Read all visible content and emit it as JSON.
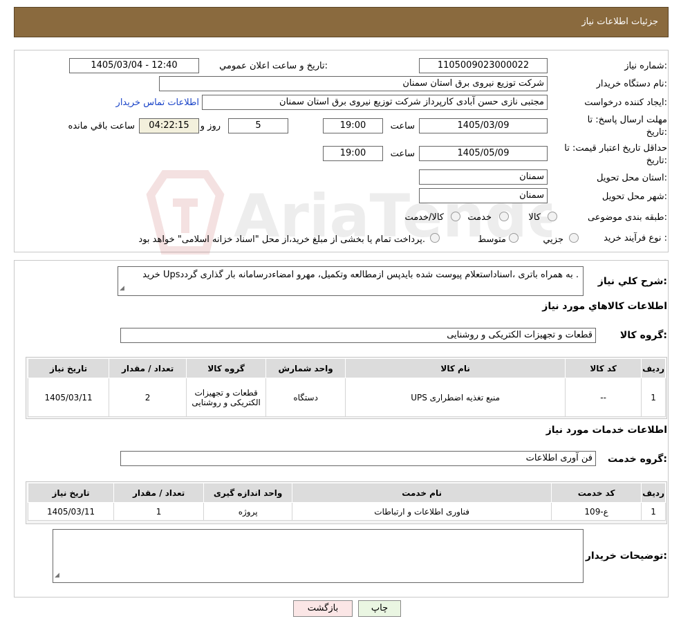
{
  "header": {
    "title": "جزئیات اطلاعات نیاز"
  },
  "info": {
    "need_no_label": "شماره نیاز:",
    "need_no": "1105009023000022",
    "announce_label": "تاریخ و ساعت اعلان عمومي:",
    "announce_value": "1405/03/04 - 12:40",
    "buyer_org_label": "نام دستگاه خریدار:",
    "buyer_org": "شرکت توزیع نیروی برق استان سمنان",
    "creator_label": "ایجاد کننده درخواست:",
    "creator": "مجتبی نازی حسن آبادی کارپرداز شرکت توزیع نیروی برق استان سمنان",
    "contact_link": "اطلاعات تماس خریدار",
    "deadline_label_1": "مهلت ارسال پاسخ: تا",
    "deadline_label_2": "تاریخ:",
    "deadline_date": "1405/03/09",
    "time_label": "ساعت",
    "deadline_time": "19:00",
    "days_value": "5",
    "days_label": "روز و",
    "remaining_time": "04:22:15",
    "remaining_label": "ساعت باقي مانده",
    "validity_label_1": "حداقل تاریخ اعتبار قیمت: تا",
    "validity_label_2": "تاریخ:",
    "validity_date": "1405/05/09",
    "validity_time": "19:00",
    "province_label": "استان محل تحویل:",
    "province": "سمنان",
    "city_label": "شهر محل تحویل:",
    "city": "سمنان",
    "category_label": "طبقه بندی موضوعی:",
    "category_options": [
      "کالا",
      "خدمت",
      "کالا/خدمت"
    ],
    "process_label": "نوع فرآیند خرید :",
    "process_options": [
      "جزیي",
      "متوسط"
    ],
    "process_note": "پرداخت تمام یا بخشی از مبلغ خرید،از محل \"اسناد خزانه اسلامی\" خواهد بود."
  },
  "summary": {
    "label": "شرح کلي نياز:",
    "text": "خرید Upsبه همراه باتری ،اسناداستعلام پیوست شده بایدپس ازمطالعه وتکمیل، مهرو امضاءدرسامانه بار گذاری گردد ."
  },
  "goods": {
    "section_title": "اطلاعات کالاهاي مورد نياز",
    "group_label": "گروه کالا:",
    "group_value": "قطعات و تجهیزات الکتریکی و روشنایی",
    "headers": [
      "رديف",
      "کد کالا",
      "نام کالا",
      "واحد شمارش",
      "گروه کالا",
      "تعداد / مقدار",
      "تاریخ نیاز"
    ],
    "rows": [
      [
        "1",
        "--",
        "منبع تغذیه اضطراری UPS",
        "دستگاه",
        "قطعات و تجهیزات الکتریکی و روشنایی",
        "2",
        "1405/03/11"
      ]
    ]
  },
  "services": {
    "section_title": "اطلاعات خدمات مورد نياز",
    "group_label": "گروه خدمت:",
    "group_value": "فن آوری اطلاعات",
    "headers": [
      "رديف",
      "کد خدمت",
      "نام خدمت",
      "واحد اندازه گیری",
      "تعداد / مقدار",
      "تاریخ نیاز"
    ],
    "rows": [
      [
        "1",
        "ع-109",
        "فناوری اطلاعات و ارتباطات",
        "پروژه",
        "1",
        "1405/03/11"
      ]
    ]
  },
  "buyer_notes": {
    "label": "توضیحات خریدار:",
    "text": ""
  },
  "buttons": {
    "print": "چاپ",
    "back": "بازگشت"
  },
  "watermark": {
    "text": "AriaTender.neT"
  },
  "colors": {
    "header": "#8a6a3e",
    "link": "#1a44c8",
    "back_button": "#fbe6e6",
    "print_button": "#eaf6e2"
  }
}
